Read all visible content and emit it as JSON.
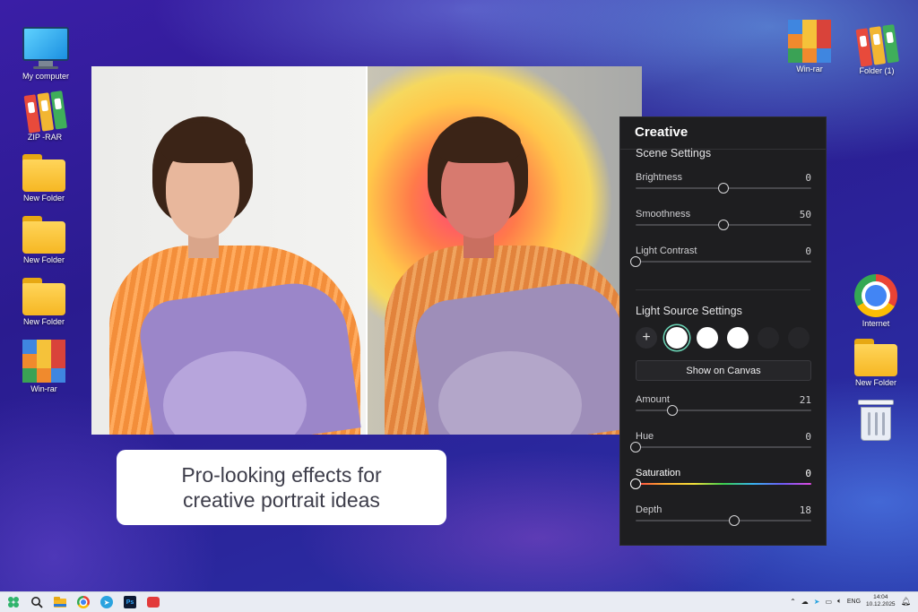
{
  "desktop": {
    "left_icons": [
      {
        "label": "My computer",
        "icon": "computer-icon"
      },
      {
        "label": "ZIP -RAR",
        "icon": "archive-icon"
      },
      {
        "label": "New Folder",
        "icon": "folder-icon"
      },
      {
        "label": "New Folder",
        "icon": "folder-icon"
      },
      {
        "label": "New Folder",
        "icon": "folder-icon"
      },
      {
        "label": "Win-rar",
        "icon": "winrar-icon"
      }
    ],
    "top_right_icons": [
      {
        "label": "Win-rar",
        "icon": "winrar-icon"
      },
      {
        "label": "Folder (1)",
        "icon": "archive-icon"
      }
    ],
    "right_icons": [
      {
        "label": "Internet",
        "icon": "chrome-icon"
      },
      {
        "label": "New Folder",
        "icon": "folder-icon"
      },
      {
        "label": "",
        "icon": "recycle-bin-icon"
      }
    ]
  },
  "caption": {
    "line1": "Pro-looking effects for",
    "line2": "creative portrait ideas"
  },
  "panel": {
    "title": "Creative",
    "scene_settings": {
      "title": "Scene Settings",
      "sliders": [
        {
          "label": "Brightness",
          "value": "0",
          "fraction": 0.5
        },
        {
          "label": "Smoothness",
          "value": "50",
          "fraction": 0.5
        },
        {
          "label": "Light Contrast",
          "value": "0",
          "fraction": 0.0
        }
      ]
    },
    "light_source_settings": {
      "title": "Light Source Settings",
      "swatches": [
        "add",
        "selected-white",
        "white",
        "white",
        "empty",
        "empty"
      ],
      "show_on_canvas": "Show on Canvas",
      "sliders": [
        {
          "label": "Amount",
          "value": "21",
          "fraction": 0.21,
          "rainbow": false
        },
        {
          "label": "Hue",
          "value": "0",
          "fraction": 0.0,
          "rainbow": false
        },
        {
          "label": "Saturation",
          "value": "0",
          "fraction": 0.0,
          "rainbow": true
        },
        {
          "label": "Depth",
          "value": "18",
          "fraction": 0.56,
          "rainbow": false
        }
      ]
    }
  },
  "taskbar": {
    "language": "ENG",
    "time": "14:04",
    "date": "10.12.2025"
  },
  "colors": {
    "accent_selected_swatch": "#6bd6b7",
    "panel_background": "#1e1e20",
    "caption_text": "#3d3d4a"
  }
}
